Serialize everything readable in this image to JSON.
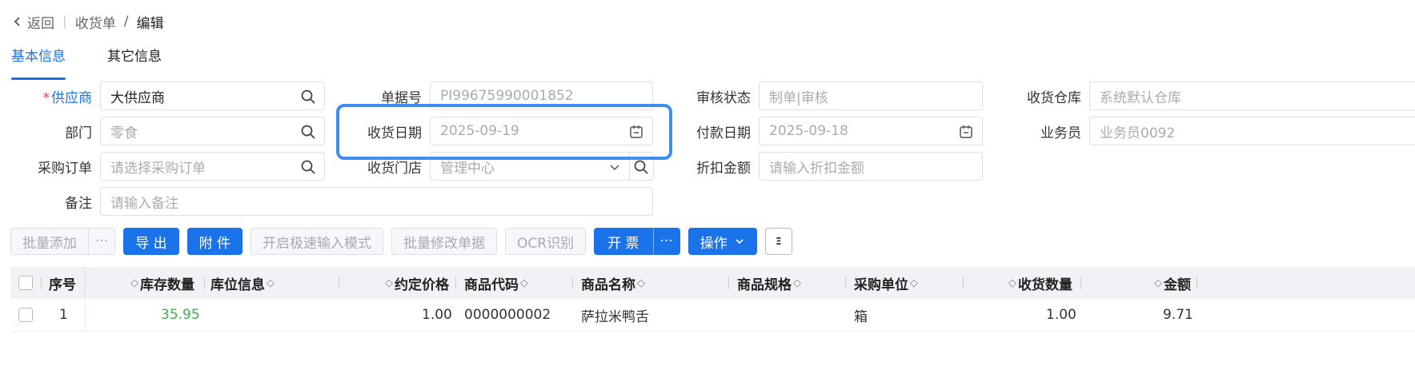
{
  "nav": {
    "back": "返回",
    "crumb_parent": "收货单",
    "crumb_sep": "/",
    "crumb_current": "编辑"
  },
  "tabs": [
    {
      "label": "基本信息",
      "active": true
    },
    {
      "label": "其它信息",
      "active": false
    }
  ],
  "form": {
    "supplier": {
      "label": "供应商",
      "required": "*",
      "value": "大供应商"
    },
    "doc_no": {
      "label": "单据号",
      "value": "PI99675990001852"
    },
    "audit_status": {
      "label": "审核状态",
      "value": "制单|审核"
    },
    "warehouse": {
      "label": "收货仓库",
      "value": "系统默认仓库"
    },
    "dept": {
      "label": "部门",
      "value": "零食"
    },
    "receive_date": {
      "label": "收货日期",
      "value": "2025-09-19"
    },
    "pay_date": {
      "label": "付款日期",
      "value": "2025-09-18"
    },
    "clerk": {
      "label": "业务员",
      "value": "业务员0092"
    },
    "purchase_order": {
      "label": "采购订单",
      "placeholder": "请选择采购订单"
    },
    "store": {
      "label": "收货门店",
      "value": "管理中心"
    },
    "discount": {
      "label": "折扣金额",
      "placeholder": "请输入折扣金额"
    },
    "remark": {
      "label": "备注",
      "placeholder": "请输入备注"
    }
  },
  "toolbar": {
    "batch_add": "批量添加",
    "more": "···",
    "export": "导 出",
    "attach": "附 件",
    "fast_input": "开启极速输入模式",
    "batch_edit": "批量修改单据",
    "ocr": "OCR识别",
    "invoice": "开 票",
    "operate": "操作",
    "column_icon": "Ξ"
  },
  "table": {
    "headers": {
      "seq": "序号",
      "stock_qty": "库存数量",
      "location": "库位信息",
      "price": "约定价格",
      "code": "商品代码",
      "name": "商品名称",
      "spec": "商品规格",
      "unit": "采购单位",
      "recv_qty": "收货数量",
      "amount": "金额"
    },
    "rows": [
      {
        "seq": "1",
        "stock_qty": "35.95",
        "location": "",
        "price": "1.00",
        "code": "0000000002",
        "name": "萨拉米鸭舌",
        "spec": "",
        "unit": "箱",
        "recv_qty": "1.00",
        "amount": "9.71"
      }
    ]
  },
  "colors": {
    "accent": "#1a73e8",
    "highlight": "#3d8ef0",
    "stock_green": "#3cb14a",
    "required": "#e53935"
  }
}
